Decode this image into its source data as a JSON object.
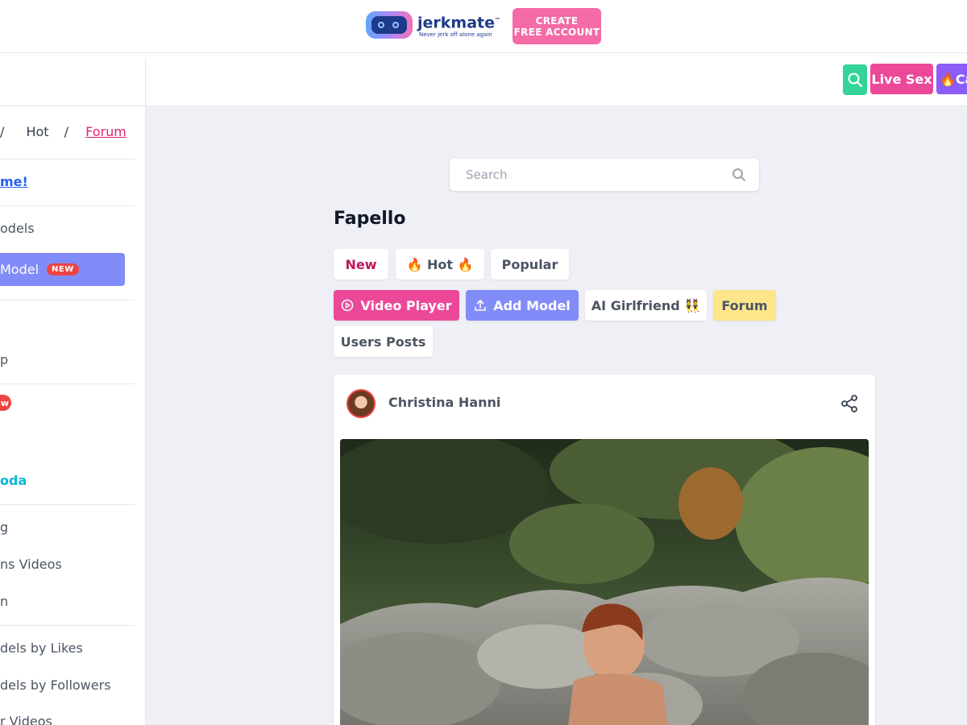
{
  "ad": {
    "brand_name": "jerkmate",
    "brand_trademark": "™",
    "brand_tagline": "Never jerk off alone again",
    "cta_line1": "CREATE",
    "cta_line2": "FREE ACCOUNT",
    "cta_color": "#f46ba7"
  },
  "header": {
    "live_sex_label": "Live Sex",
    "cam_label": "🔥Ca",
    "search_button_color": "#34d399",
    "live_color": "#ec4899",
    "cam_color": "#8b5cf6"
  },
  "sidebar": {
    "breadcrumb": {
      "sep1": "/",
      "hot": "Hot",
      "sep2": "/",
      "forum": "Forum"
    },
    "welcome": "me!",
    "models": "odels",
    "add_model": "Model",
    "new_badge": "NEW",
    "item_p": "p",
    "new_partial": "ew",
    "oda": "oda",
    "item_g": "g",
    "ns_videos": "ns Videos",
    "item_n": "n",
    "by_likes": "dels by Likes",
    "by_followers": "dels by Followers",
    "r_videos": "r Videos"
  },
  "main": {
    "search_placeholder": "Search",
    "title": "Fapello",
    "tabs": {
      "new": "New",
      "hot": "🔥 Hot 🔥",
      "popular": "Popular"
    },
    "actions": {
      "video_player": "Video Player",
      "add_model": "Add Model",
      "ai_girlfriend": "AI Girlfriend 👯",
      "forum": "Forum",
      "users_posts": "Users Posts"
    }
  },
  "post": {
    "author": "Christina Hanni",
    "share_icon": "share-icon"
  }
}
